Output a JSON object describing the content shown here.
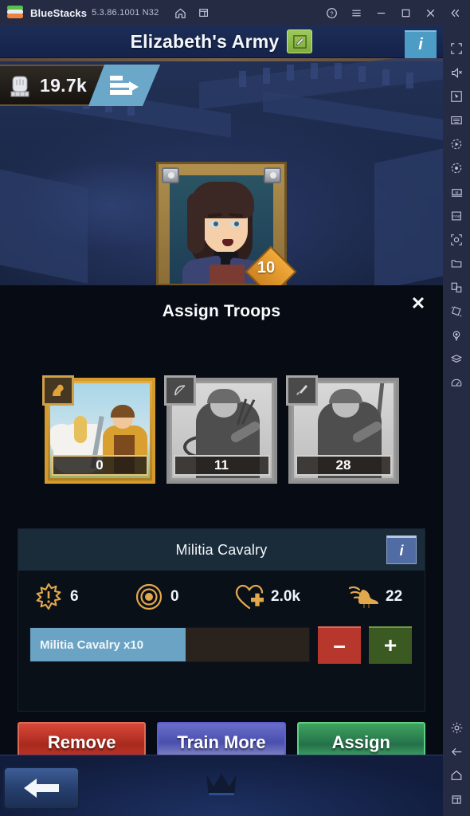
{
  "bluestacks": {
    "app_name": "BlueStacks",
    "version": "5.3.86.1001 N32",
    "icons": {
      "logo": "bluestacks-logo",
      "home": "home-icon",
      "multi_instance": "multi-instance-icon",
      "help": "help-circle-icon",
      "menu": "hamburger-menu-icon",
      "minimize": "minimize-icon",
      "maximize": "maximize-icon",
      "close": "close-icon",
      "collapse": "collapse-chevrons-icon"
    }
  },
  "sidebar": {
    "items": [
      {
        "name": "fullscreen-icon",
        "label": "Fullscreen"
      },
      {
        "name": "mute-icon",
        "label": "Mute"
      },
      {
        "name": "cursor-icon",
        "label": "Controls"
      },
      {
        "name": "keymapping-icon",
        "label": "Game controls"
      },
      {
        "name": "macro-play-icon",
        "label": "Macro"
      },
      {
        "name": "record-icon",
        "label": "Record"
      },
      {
        "name": "multi-instance-manager-icon",
        "label": "Multi-instance"
      },
      {
        "name": "sync-operations-icon",
        "label": "Sync operations"
      },
      {
        "name": "screenshot-icon",
        "label": "Screenshot"
      },
      {
        "name": "media-folder-icon",
        "label": "Media folder"
      },
      {
        "name": "rotate-icon",
        "label": "Rotate"
      },
      {
        "name": "shake-icon",
        "label": "Shake"
      },
      {
        "name": "location-icon",
        "label": "Location"
      },
      {
        "name": "layers-icon",
        "label": "Eco mode"
      },
      {
        "name": "performance-icon",
        "label": "Performance"
      }
    ],
    "bottom_items": [
      {
        "name": "settings-gear-icon",
        "label": "Settings"
      },
      {
        "name": "back-arrow-icon",
        "label": "Back"
      },
      {
        "name": "android-home-icon",
        "label": "Home"
      },
      {
        "name": "recent-apps-icon",
        "label": "Recents"
      }
    ]
  },
  "game": {
    "title": "Elizabeth's Army",
    "edit_icon": "edit-pencil-icon",
    "info_button": "i",
    "power": {
      "icon": "fist-power-icon",
      "value": "19.7k",
      "march_icon": "march-arrow-icon"
    },
    "hero": {
      "portrait": "hero-portrait",
      "level": "10"
    }
  },
  "modal": {
    "title": "Assign Troops",
    "close_icon": "close-x-icon",
    "troop_cards": [
      {
        "name": "militia-cavalry-card",
        "type_icon": "horse-icon",
        "count": "0",
        "selected": true
      },
      {
        "name": "archer-card",
        "type_icon": "bow-icon",
        "count": "11",
        "selected": false
      },
      {
        "name": "infantry-card",
        "type_icon": "sword-icon",
        "count": "28",
        "selected": false
      }
    ],
    "info_panel": {
      "unit_name": "Militia Cavalry",
      "info_button": "i",
      "stats": [
        {
          "icon": "attack-burst-icon",
          "value": "6",
          "label": "Attack"
        },
        {
          "icon": "defense-target-icon",
          "value": "0",
          "label": "Defense"
        },
        {
          "icon": "health-heart-icon",
          "value": "2.0k",
          "label": "Health"
        },
        {
          "icon": "speed-winged-boot-icon",
          "value": "22",
          "label": "Speed"
        }
      ],
      "quantity": {
        "tag_label": "Militia Cavalry x10",
        "field_value": "",
        "minus_label": "–",
        "plus_label": "+"
      }
    },
    "actions": [
      {
        "name": "remove-button",
        "label": "Remove",
        "color": "#b8372c"
      },
      {
        "name": "train-more-button",
        "label": "Train More",
        "color": "#4a4fae"
      },
      {
        "name": "assign-button",
        "label": "Assign",
        "color": "#3fa35f"
      }
    ]
  },
  "bottom_nav": {
    "back_icon": "back-arrow-icon",
    "crown_icon": "crown-icon"
  },
  "colors": {
    "accent_blue": "#4d9cc6",
    "gold": "#e0ae47",
    "panel_dark": "#070b14",
    "bluestacks_bar": "#262b44"
  }
}
